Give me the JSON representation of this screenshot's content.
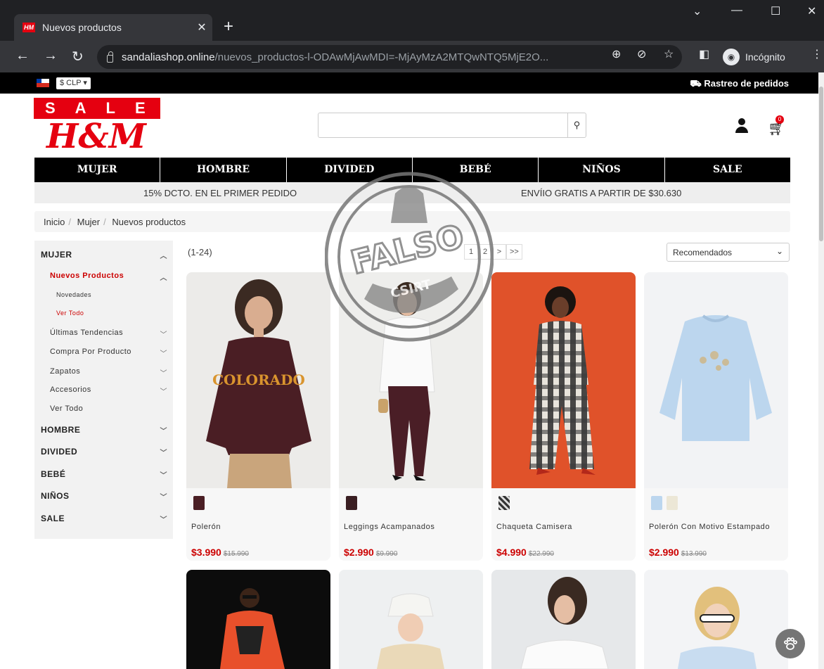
{
  "browser": {
    "tab_title": "Nuevos productos",
    "favicon_text": "HM",
    "url_host": "sandaliashop.online",
    "url_path": "/nuevos_productos-l-ODAwMjAwMDI=-MjAyMzA2MTQwNTQ5MjE2O...",
    "incognito_label": "Incógnito"
  },
  "topbar": {
    "currency": "$ CLP ▾",
    "tracking": "Rastreo de pedidos"
  },
  "logo": {
    "line1": "SALE",
    "line2": "H&M"
  },
  "header": {
    "cart_count": "0"
  },
  "nav": [
    "MUJER",
    "HOMBRE",
    "DIVIDED",
    "BEBÉ",
    "NIÑOS",
    "SALE"
  ],
  "promo": {
    "left": "15% DCTO. EN EL PRIMER PEDIDO",
    "right": "ENVÍIO GRATIS A PARTIR DE $30.630"
  },
  "breadcrumb": [
    "Inicio",
    "Mujer",
    "Nuevos productos"
  ],
  "sidebar": {
    "mujer": "MUJER",
    "nuevos": "Nuevos Productos",
    "novedades": "Novedades",
    "ver_todo_sub": "Ver Todo",
    "tendencias": "Últimas Tendencias",
    "compra": "Compra Por Producto",
    "zapatos": "Zapatos",
    "accesorios": "Accesorios",
    "ver_todo": "Ver Todo",
    "hombre": "HOMBRE",
    "divided": "DIVIDED",
    "bebe": "BEBÉ",
    "ninos": "NIÑOS",
    "sale": "SALE"
  },
  "listing": {
    "count": "(1-24)",
    "pages": [
      "1",
      "2",
      ">",
      ">>"
    ],
    "sort": "Recomendados"
  },
  "products": [
    {
      "name": "Polerón",
      "price": "$3.990",
      "old_price": "$15.990",
      "print": "COLORADO"
    },
    {
      "name": "Leggings Acampanados",
      "price": "$2.990",
      "old_price": "$9.990"
    },
    {
      "name": "Chaqueta Camisera",
      "price": "$4.990",
      "old_price": "$22.990"
    },
    {
      "name": "Polerón Con Motivo Estampado",
      "price": "$2.990",
      "old_price": "$13.990"
    }
  ],
  "stamp": {
    "text": "FALSO",
    "sub": "CSIRT"
  },
  "colors": {
    "brand": "#e50010",
    "sale_price": "#cc0000"
  }
}
